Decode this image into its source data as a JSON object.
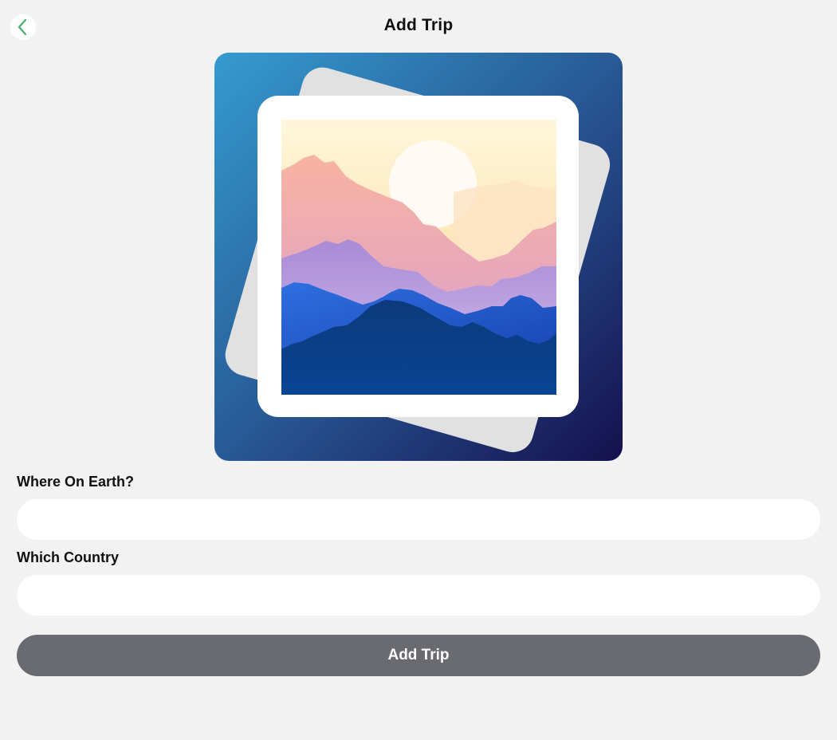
{
  "header": {
    "title": "Add Trip",
    "back_icon": "chevron-left-icon"
  },
  "image_picker": {
    "icon": "landscape-photo-placeholder-icon"
  },
  "form": {
    "where_label": "Where On Earth?",
    "where_value": "",
    "where_placeholder": "",
    "country_label": "Which Country",
    "country_value": "",
    "country_placeholder": "",
    "submit_label": "Add Trip"
  },
  "colors": {
    "background": "#f2f2f2",
    "back_chevron": "#4caf68",
    "button_bg": "#696b70",
    "button_text": "#ffffff",
    "input_bg": "#ffffff"
  }
}
